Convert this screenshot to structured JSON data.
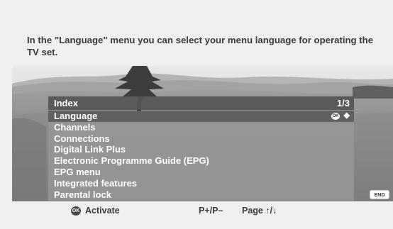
{
  "intro_text": "In the \"Language\" menu you can select your menu language for operating the TV set.",
  "menu": {
    "title": "Index",
    "page": "1/3",
    "items": [
      {
        "label": "Language",
        "selected": true,
        "badge": "OK",
        "arrows": "◆"
      },
      {
        "label": "Channels"
      },
      {
        "label": "Connections"
      },
      {
        "label": "Digital Link Plus"
      },
      {
        "label": "Electronic Programme Guide (EPG)"
      },
      {
        "label": "EPG menu"
      },
      {
        "label": "Integrated features"
      },
      {
        "label": "Parental lock"
      }
    ]
  },
  "end_button": "END",
  "footer": {
    "ok_badge": "OK",
    "activate_label": "Activate",
    "pkeys_label": "P+/P–",
    "page_label": "Page ↑/↓"
  },
  "colors": {
    "menu_header_bg": "#555555",
    "menu_list_bg": "#969696",
    "selected_bg": "#616161"
  }
}
